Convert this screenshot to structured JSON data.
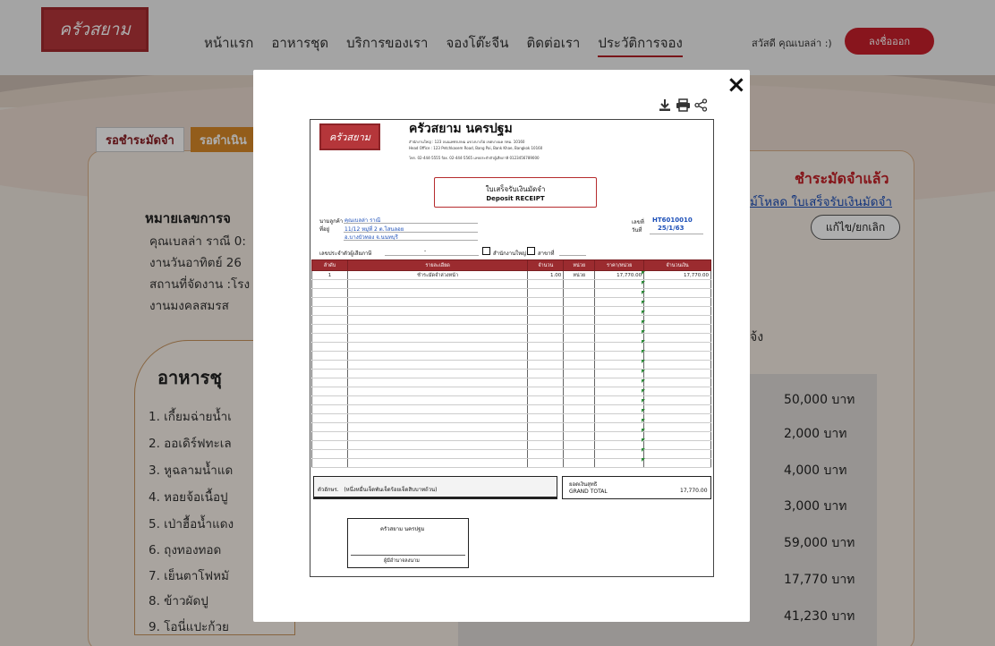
{
  "brand": {
    "logo_text": "ครัวสยาม",
    "accent": "#b5363a"
  },
  "nav": {
    "items": [
      "หน้าแรก",
      "อาหารชุด",
      "บริการของเรา",
      "จองโต๊ะจีน",
      "ติดต่อเรา",
      "ประวัติการจอง"
    ],
    "greeting": "สวัสดี คุณเบลล่า :)",
    "logout": "ลงชื่อออก"
  },
  "tabs": [
    "รอชำระมัดจำ",
    "รอดำเนิน"
  ],
  "page": {
    "booking_heading": "หมายเลขการจ",
    "lines": [
      "คุณเบลล่า ราณี 0:",
      "งานวันอาทิตย์ 26",
      "สถานที่จัดงาน :โรง",
      "งานมงคลสมรส"
    ],
    "status": "ชำระมัดจำแล้ว",
    "download_link": "ม์โหลด ใบเสร็จรับเงินมัดจำ",
    "edit_button": "แก้ไข/ยกเลิก",
    "side_text": "จ้ง",
    "menu_title": "อาหารชุ",
    "menu_items": [
      "1. เกี้ยมฉ่ายน้ำเ",
      "2. ออเดิร์ฟทะเล",
      "3. หูฉลามน้ำแด",
      "4. หอยจ้อเนื้อปู",
      "5. เป่าฮื้อน้ำแดง",
      "6. ถุงทองทอด",
      "7. เย็นตาโฟหมั",
      "8. ข้าวผัดปู",
      "9. โอนี่แปะก้วย"
    ],
    "prices": [
      "50,000 บาท",
      "2,000 บาท",
      "4,000 บาท",
      "3,000 บาท",
      "59,000 บาท",
      "17,770 บาท",
      "41,230 บาท"
    ]
  },
  "modal": {
    "close": "×",
    "tools": {
      "download_icon": "download-icon",
      "print_icon": "print-icon",
      "share_icon": "share-icon"
    }
  },
  "receipt": {
    "logo_text": "ครัวสยาม",
    "company": "ครัวสยาม นครปฐม",
    "address_th": "สำนักงานใหญ่ : 123 ถนนเพชรเกษม แขวงบางไผ่ เขตบางแค กทม. 10160",
    "address_en": "Head Office : 123 Petchkasem Road, Bang Pai, Bank Khae, Bangkok 10160",
    "contact": "โทร. 02-444-5555 fax. 02-444-5565 เลขประจำตัวผู้เสียภาษี 0123456789000",
    "title_th": "ใบเสร็จรับเงินมัดจำ",
    "title_en": "Deposit RECEIPT",
    "customer_label": "นามลูกค้า",
    "customer_name": "คุณเบลล่า ราณี",
    "address_label": "ที่อยู่",
    "address_line1": "11/12 หมู่ที่ 2 ต.โสนลอย",
    "address_line2": "อ.บางบัวทอง จ.นนทบุรี",
    "taxid_label": "เลขประจำตัวผู้เสียภาษี",
    "taxid_value": "-",
    "hq_label": "สำนักงานใหญ่",
    "branch_label": "สาขาที่",
    "no_label": "เลขที่",
    "no_value": "HT6010010",
    "date_label": "วันที่",
    "date_value": "25/1/63",
    "columns": [
      "ลำดับ",
      "รายละเอียด",
      "จำนวน",
      "หน่วย",
      "ราคา/หน่วย",
      "จำนวนเงิน"
    ],
    "rows": [
      [
        "1",
        "ชำระมัดจำล่วงหน้า",
        "1.00",
        "หน่วย",
        "17,770.00",
        "17,770.00"
      ]
    ],
    "words_label": "ตัวอักษร.",
    "words_value": "(หนึ่งหมื่นเจ็ดพันเจ็ดร้อยเจ็ดสิบบาทถ้วน)",
    "total_label_th": "ยอดเงินสุทธิ",
    "total_label_en": "GRAND TOTAL",
    "total_value": "17,770.00",
    "sign_company": "ครัวสยาม นครปฐม",
    "sign_role": "ผู้มีอำนาจลงนาม"
  }
}
